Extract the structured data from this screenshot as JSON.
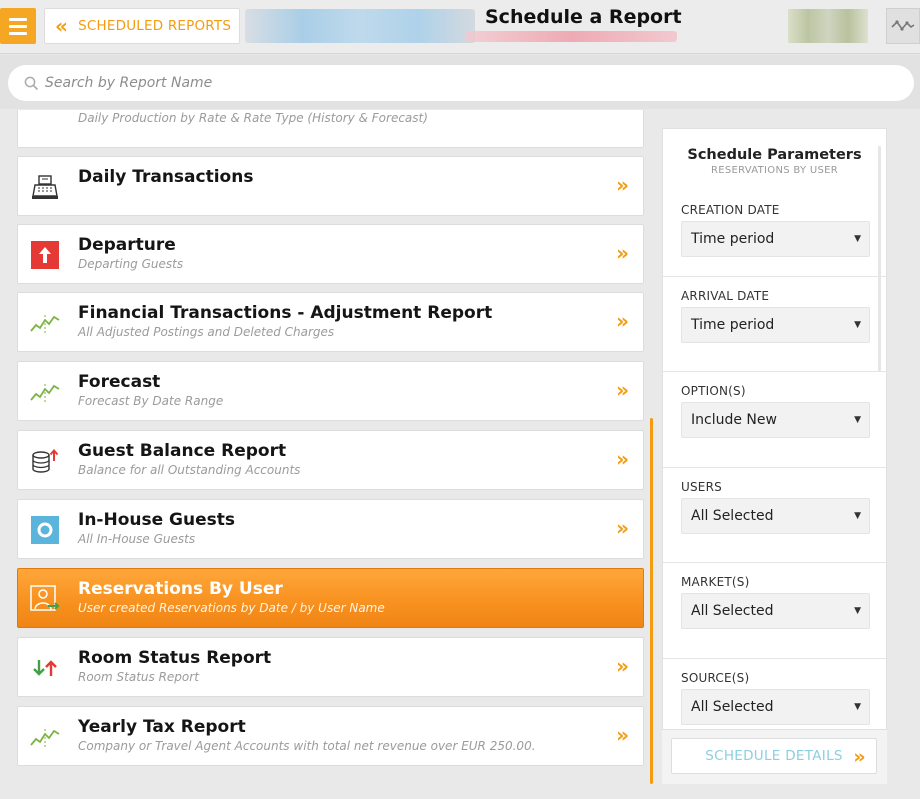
{
  "header": {
    "back_label": "SCHEDULED REPORTS",
    "page_title": "Schedule a Report",
    "back_icon": "double-chevron-left-icon",
    "menu_icon": "hamburger-icon",
    "activity_icon": "activity-icon"
  },
  "search": {
    "placeholder": "Search by Report Name"
  },
  "reports": [
    {
      "title": "",
      "desc": "Daily Production by Rate & Rate Type (History & Forecast)",
      "icon": "chart-icon"
    },
    {
      "title": "Daily Transactions",
      "desc": "",
      "icon": "cash-register-icon"
    },
    {
      "title": "Departure",
      "desc": "Departing Guests",
      "icon": "arrow-up-icon"
    },
    {
      "title": "Financial Transactions - Adjustment Report",
      "desc": "All Adjusted Postings and Deleted Charges",
      "icon": "trend-chart-icon"
    },
    {
      "title": "Forecast",
      "desc": "Forecast By Date Range",
      "icon": "trend-chart-icon"
    },
    {
      "title": "Guest Balance Report",
      "desc": "Balance for all Outstanding Accounts",
      "icon": "coins-icon"
    },
    {
      "title": "In-House Guests",
      "desc": "All In-House Guests",
      "icon": "circle-icon"
    },
    {
      "title": "Reservations By User",
      "desc": "User created Reservations by Date / by User Name",
      "icon": "user-arrow-icon",
      "active": true
    },
    {
      "title": "Room Status Report",
      "desc": "Room Status Report",
      "icon": "up-down-arrows-icon"
    },
    {
      "title": "Yearly Tax Report",
      "desc": "Company or Travel Agent Accounts with total net revenue over EUR 250.00.",
      "icon": "trend-chart-icon"
    }
  ],
  "panel": {
    "title": "Schedule Parameters",
    "subtitle": "RESERVATIONS BY USER",
    "params": [
      {
        "label": "CREATION DATE",
        "value": "Time period"
      },
      {
        "label": "ARRIVAL DATE",
        "value": "Time period"
      },
      {
        "label": "OPTION(S)",
        "value": "Include New"
      },
      {
        "label": "USERS",
        "value": "All Selected"
      },
      {
        "label": "MARKET(S)",
        "value": "All Selected"
      },
      {
        "label": "SOURCE(S)",
        "value": "All Selected"
      }
    ],
    "schedule_label": "SCHEDULE DETAILS"
  },
  "colors": {
    "accent": "#f39c12",
    "active_row": "#f7901e",
    "link_blue": "#8ccfe0",
    "departure_red": "#e53935",
    "chart_green": "#7cb342"
  }
}
